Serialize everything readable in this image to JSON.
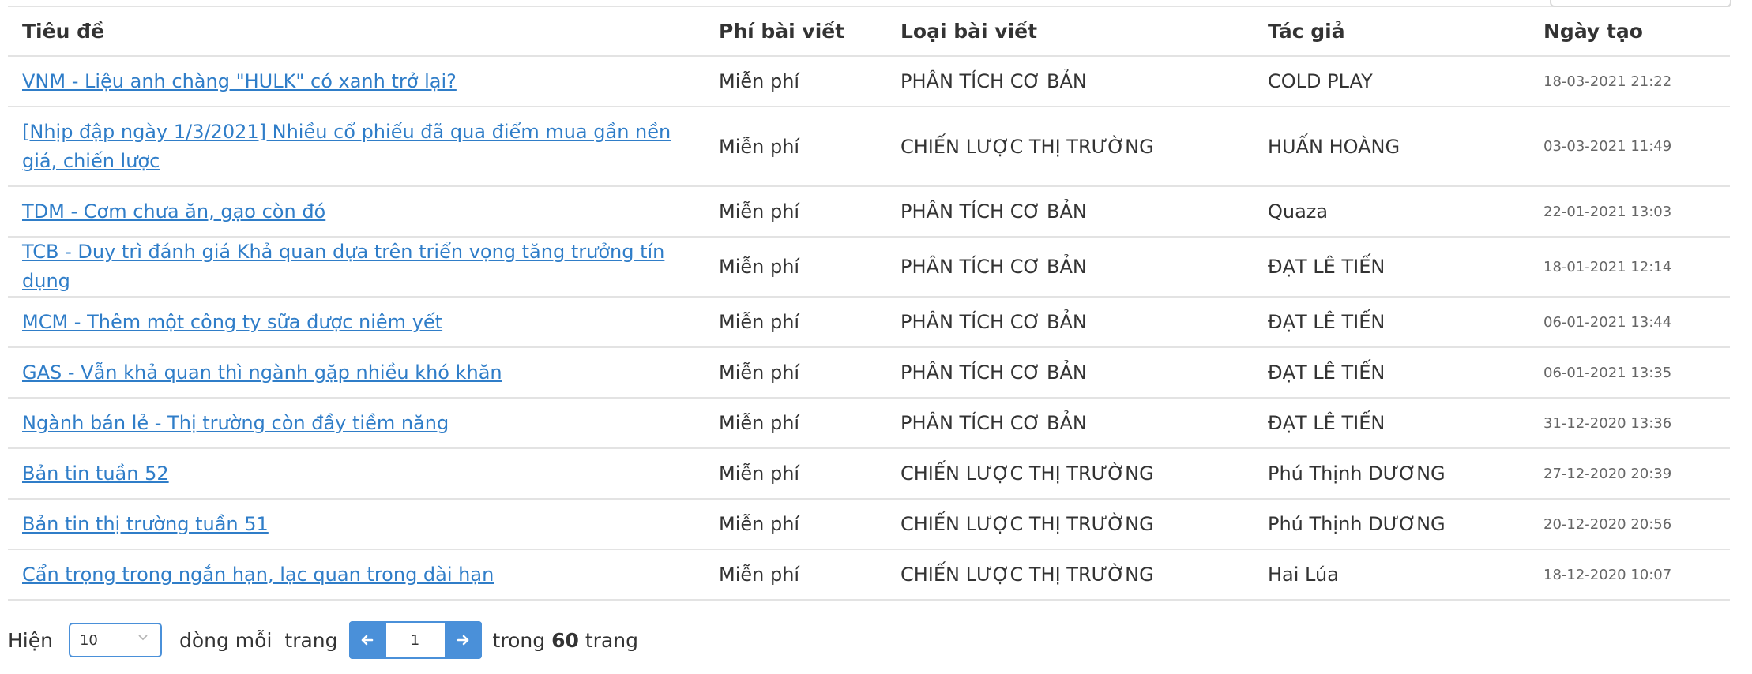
{
  "table": {
    "headers": {
      "title": "Tiêu đề",
      "fee": "Phí bài viết",
      "type": "Loại bài viết",
      "author": "Tác giả",
      "date": "Ngày tạo"
    },
    "rows": [
      {
        "title": "VNM - Liệu anh chàng \"HULK\" có xanh trở lại?",
        "fee": "Miễn phí",
        "type": "PHÂN TÍCH CƠ BẢN",
        "author": "COLD PLAY",
        "date": "18-03-2021 21:22"
      },
      {
        "title": "[Nhịp đập ngày 1/3/2021] Nhiều cổ phiếu đã qua điểm mua gần nền giá, chiến lược",
        "fee": "Miễn phí",
        "type": "CHIẾN LƯỢC THỊ TRƯỜNG",
        "author": "HUẤN HOÀNG",
        "date": "03-03-2021 11:49"
      },
      {
        "title": "TDM - Cơm chưa ăn, gạo còn đó",
        "fee": "Miễn phí",
        "type": "PHÂN TÍCH CƠ BẢN",
        "author": "Quaza",
        "date": "22-01-2021 13:03"
      },
      {
        "title": "TCB - Duy trì đánh giá Khả quan dựa trên triển vọng tăng trưởng tín dụng",
        "fee": "Miễn phí",
        "type": "PHÂN TÍCH CƠ BẢN",
        "author": "ĐẠT LÊ TIẾN",
        "date": "18-01-2021 12:14"
      },
      {
        "title": "MCM - Thêm một công ty sữa được niêm yết",
        "fee": "Miễn phí",
        "type": "PHÂN TÍCH CƠ BẢN",
        "author": "ĐẠT LÊ TIẾN",
        "date": "06-01-2021 13:44"
      },
      {
        "title": "GAS - Vẫn khả quan thì ngành gặp nhiều khó khăn",
        "fee": "Miễn phí",
        "type": "PHÂN TÍCH CƠ BẢN",
        "author": "ĐẠT LÊ TIẾN",
        "date": "06-01-2021 13:35"
      },
      {
        "title": "Ngành bán lẻ - Thị trường còn đầy tiềm năng",
        "fee": "Miễn phí",
        "type": "PHÂN TÍCH CƠ BẢN",
        "author": "ĐẠT LÊ TIẾN",
        "date": "31-12-2020 13:36"
      },
      {
        "title": "Bản tin tuần 52",
        "fee": "Miễn phí",
        "type": "CHIẾN LƯỢC THỊ TRƯỜNG",
        "author": "Phú Thịnh DƯƠNG",
        "date": "27-12-2020 20:39"
      },
      {
        "title": "Bản tin thị trường tuần 51",
        "fee": "Miễn phí",
        "type": "CHIẾN LƯỢC THỊ TRƯỜNG",
        "author": "Phú Thịnh DƯƠNG",
        "date": "20-12-2020 20:56"
      },
      {
        "title": "Cẩn trọng trong ngắn hạn, lạc quan trong dài hạn",
        "fee": "Miễn phí",
        "type": "CHIẾN LƯỢC THỊ TRƯỜNG",
        "author": "Hai Lúa",
        "date": "18-12-2020 10:07"
      }
    ]
  },
  "pagination": {
    "show_label": "Hiện",
    "page_size": "10",
    "per_page_label": "dòng mỗi",
    "page_label": "trang",
    "current_page": "1",
    "of_label": "trong",
    "total_pages": "60",
    "pages_label": "trang"
  },
  "colors": {
    "accent": "#4a90d9",
    "link": "#2f7dc8",
    "border": "#e3e3e3"
  },
  "icons": {
    "prev": "arrow-left-icon",
    "next": "arrow-right-icon",
    "dropdown": "chevron-down-icon"
  }
}
